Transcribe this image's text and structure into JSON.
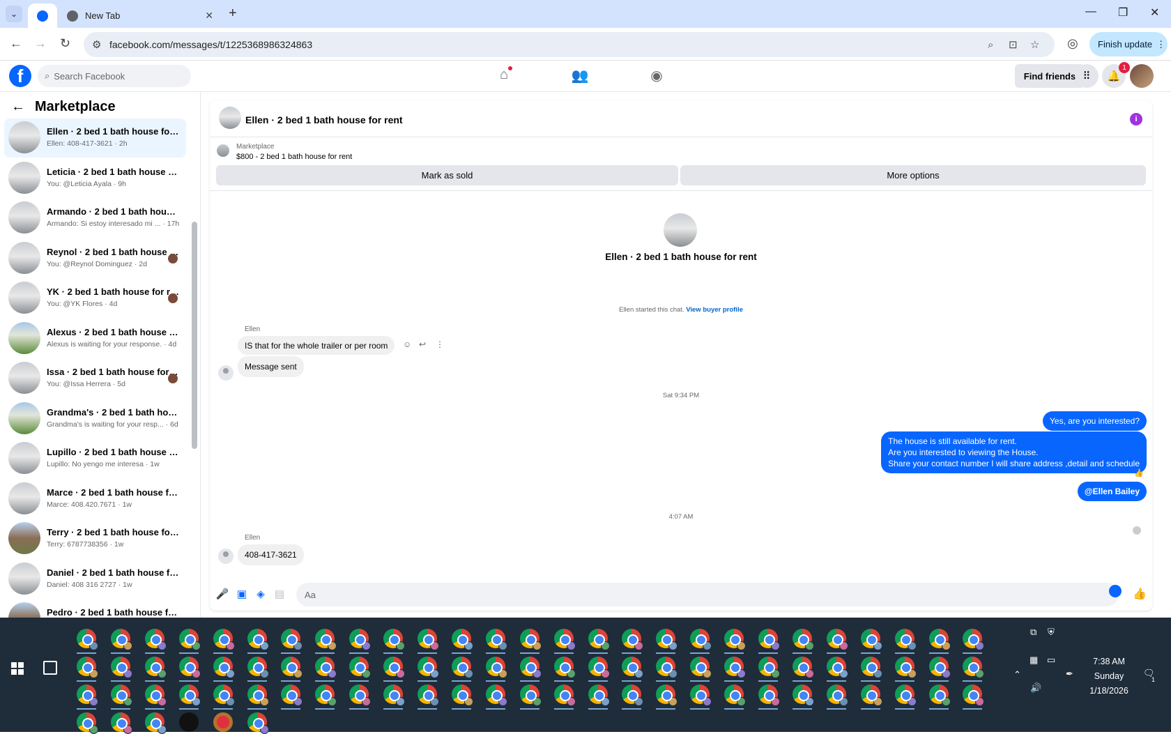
{
  "browser": {
    "tabs": [
      {
        "label": ""
      },
      {
        "label": "New Tab"
      }
    ],
    "url": "facebook.com/messages/t/1225368986324863",
    "finish_update": "Finish update"
  },
  "fb": {
    "search_placeholder": "Search Facebook",
    "find_friends": "Find friends",
    "notification_count": "1"
  },
  "sidebar": {
    "title": "Marketplace",
    "conversations": [
      {
        "name": "Ellen · 2 bed 1 bath house for rent",
        "sub": "Ellen: 408-417-3621 · 2h",
        "active": true
      },
      {
        "name": "Leticia · 2 bed 1 bath house for ...",
        "sub": "You: @Leticia Ayala · 9h"
      },
      {
        "name": "Armando · 2 bed 1 bath house f...",
        "sub": "Armando: Si estoy interesado mi ... · 17h"
      },
      {
        "name": "Reynol · 2 bed 1 bath house f...",
        "sub": "You: @Reynol Dominguez · 2d"
      },
      {
        "name": "YK · 2 bed 1 bath house for re...",
        "sub": "You: @YK Flores · 4d"
      },
      {
        "name": "Alexus · 2 bed 1 bath house for ...",
        "sub": "Alexus is waiting for your response. · 4d"
      },
      {
        "name": "Issa · 2 bed 1 bath house for r...",
        "sub": "You: @Issa Herrera · 5d"
      },
      {
        "name": "Grandma's · 2 bed 1 bath house ...",
        "sub": "Grandma's is waiting for your resp... · 6d"
      },
      {
        "name": "Lupillo · 2 bed 1 bath house for ...",
        "sub": "Lupillo: No yengo me interesa · 1w"
      },
      {
        "name": "Marce · 2 bed 1 bath house for r...",
        "sub": "Marce: 408.420.7671 · 1w"
      },
      {
        "name": "Terry · 2 bed 1 bath house for re...",
        "sub": "Terry: 6787738356 · 1w"
      },
      {
        "name": "Daniel · 2 bed 1 bath house for r...",
        "sub": "Daniel: 408 316 2727 · 1w"
      },
      {
        "name": "Pedro · 2 bed 1 bath house for r...",
        "sub": ""
      }
    ]
  },
  "chat": {
    "header_title": "Ellen · 2 bed 1 bath house for rent",
    "marketplace_label": "Marketplace",
    "listing": "$800 - 2 bed 1 bath house for rent",
    "mark_sold": "Mark as sold",
    "more_options": "More options",
    "intro_title": "Ellen · 2 bed 1 bath house for rent",
    "started_text": "Ellen started this chat.",
    "view_profile": "View buyer profile",
    "messages": {
      "sender1": "Ellen",
      "msg1": "IS that for the whole trailer or per room",
      "msg2": "Message sent",
      "stamp1": "Sat 9:34 PM",
      "out1": "Yes, are you interested?",
      "out2_l1": "The house is still available for rent.",
      "out2_l2": "Are you interested to viewing  the House.",
      "out2_l3": "Share your contact number I will share address ,detail and schedule",
      "out3": "@Ellen Bailey",
      "stamp2": "4:07 AM",
      "sender2": "Ellen",
      "msg3": "408-417-3621"
    },
    "composer_placeholder": "Aa"
  },
  "taskbar": {
    "time": "7:38 AM",
    "day": "Sunday",
    "date": "1/18/2026",
    "notif_count": "1"
  }
}
